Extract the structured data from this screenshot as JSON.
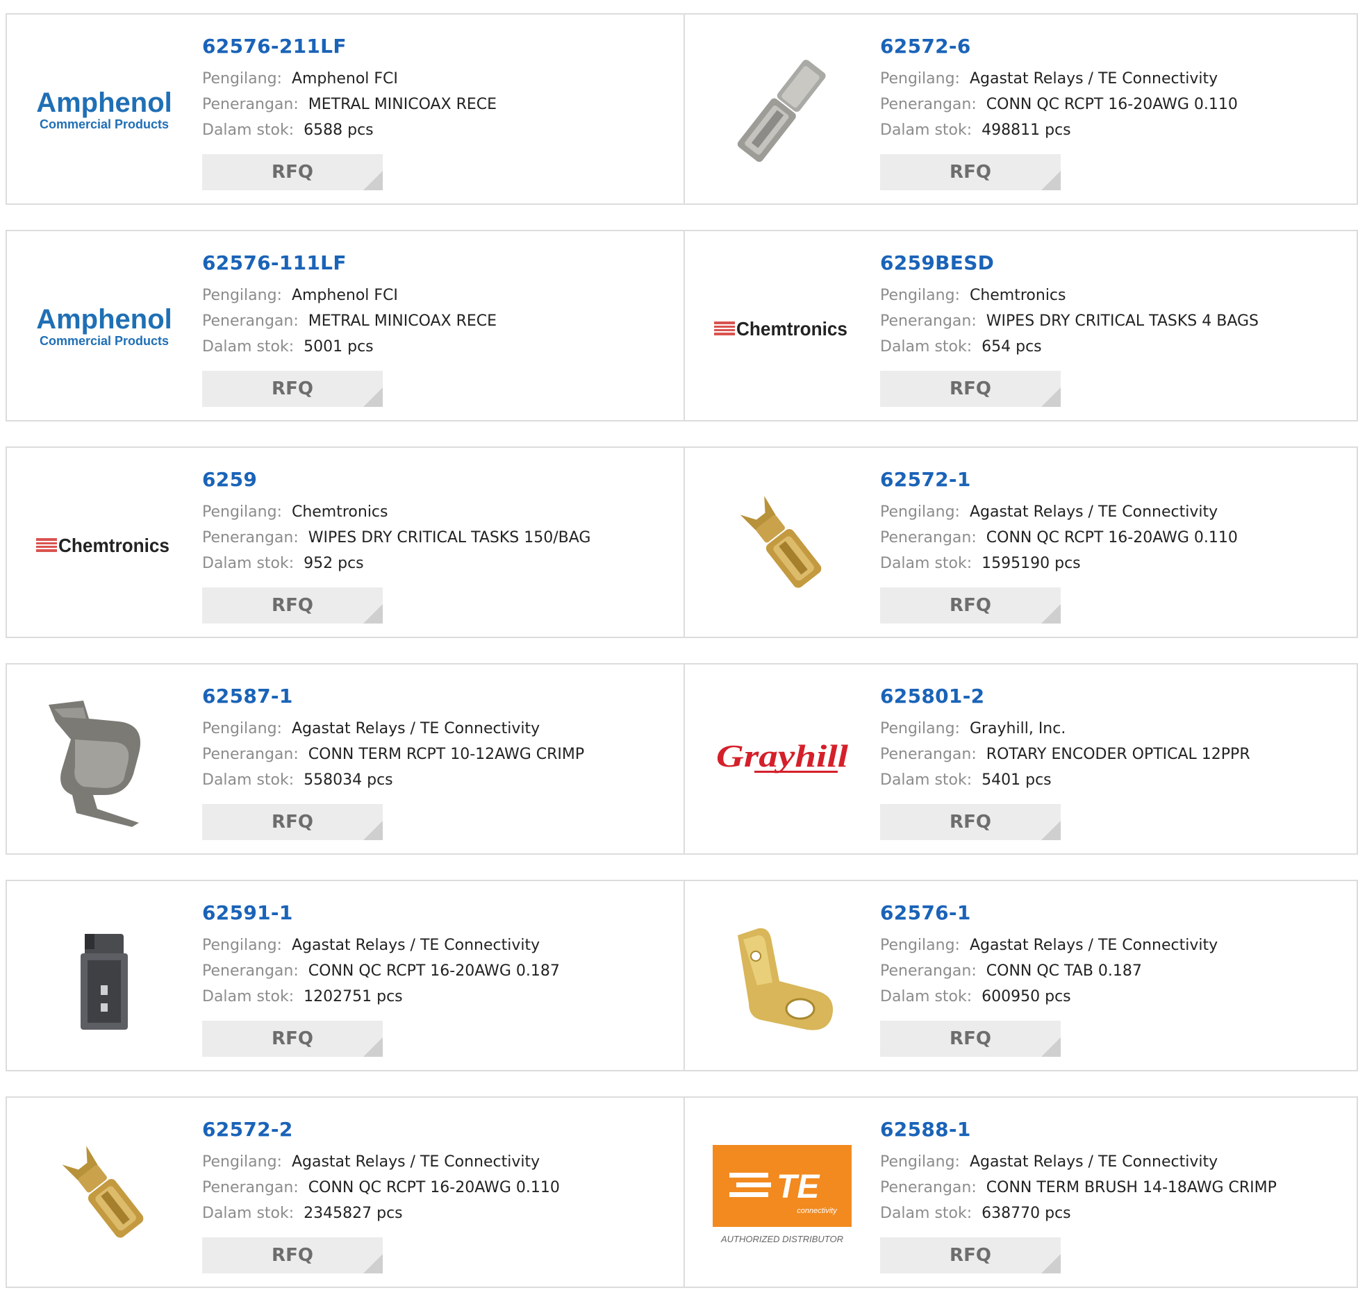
{
  "labels": {
    "manufacturer": "Pengilang:",
    "description": "Penerangan:",
    "stock": "Dalam stok:",
    "rfq": "RFQ"
  },
  "brands": {
    "amphenol_top": "Amphenol",
    "amphenol_bottom": "Commercial Products",
    "chemtronics": "Chemtronics",
    "grayhill": "Grayhill",
    "te_main": "TE",
    "te_sub": "connectivity",
    "te_tag": "AUTHORIZED DISTRIBUTOR"
  },
  "colors": {
    "link": "#1a63b8",
    "te_orange": "#f28a1f",
    "grayhill_red": "#d4202a",
    "amphenol_blue": "#1f6fb5"
  },
  "products": [
    {
      "pn": "62576-211LF",
      "mfr": "Amphenol FCI",
      "desc": "METRAL MINICOAX RECE",
      "stock": "6588 pcs",
      "image": "amphenol-logo"
    },
    {
      "pn": "62572-6",
      "mfr": "Agastat Relays / TE Connectivity",
      "desc": "CONN QC RCPT 16-20AWG 0.110",
      "stock": "498811 pcs",
      "image": "silver-receptacle"
    },
    {
      "pn": "62576-111LF",
      "mfr": "Amphenol FCI",
      "desc": "METRAL MINICOAX RECE",
      "stock": "5001 pcs",
      "image": "amphenol-logo"
    },
    {
      "pn": "6259BESD",
      "mfr": "Chemtronics",
      "desc": "WIPES DRY CRITICAL TASKS 4 BAGS",
      "stock": "654 pcs",
      "image": "chemtronics-logo"
    },
    {
      "pn": "6259",
      "mfr": "Chemtronics",
      "desc": "WIPES DRY CRITICAL TASKS 150/BAG",
      "stock": "952 pcs",
      "image": "chemtronics-logo"
    },
    {
      "pn": "62572-1",
      "mfr": "Agastat Relays / TE Connectivity",
      "desc": "CONN QC RCPT 16-20AWG 0.110",
      "stock": "1595190 pcs",
      "image": "brass-receptacle"
    },
    {
      "pn": "62587-1",
      "mfr": "Agastat Relays / TE Connectivity",
      "desc": "CONN TERM RCPT 10-12AWG CRIMP",
      "stock": "558034 pcs",
      "image": "metal-clip"
    },
    {
      "pn": "625801-2",
      "mfr": "Grayhill, Inc.",
      "desc": "ROTARY ENCODER OPTICAL 12PPR",
      "stock": "5401 pcs",
      "image": "grayhill-logo"
    },
    {
      "pn": "62591-1",
      "mfr": "Agastat Relays / TE Connectivity",
      "desc": "CONN QC RCPT 16-20AWG 0.187",
      "stock": "1202751 pcs",
      "image": "dark-receptacle"
    },
    {
      "pn": "62576-1",
      "mfr": "Agastat Relays / TE Connectivity",
      "desc": "CONN QC TAB 0.187",
      "stock": "600950 pcs",
      "image": "brass-tab"
    },
    {
      "pn": "62572-2",
      "mfr": "Agastat Relays / TE Connectivity",
      "desc": "CONN QC RCPT 16-20AWG 0.110",
      "stock": "2345827 pcs",
      "image": "brass-receptacle"
    },
    {
      "pn": "62588-1",
      "mfr": "Agastat Relays / TE Connectivity",
      "desc": "CONN TERM BRUSH 14-18AWG CRIMP",
      "stock": "638770 pcs",
      "image": "te-logo"
    }
  ]
}
